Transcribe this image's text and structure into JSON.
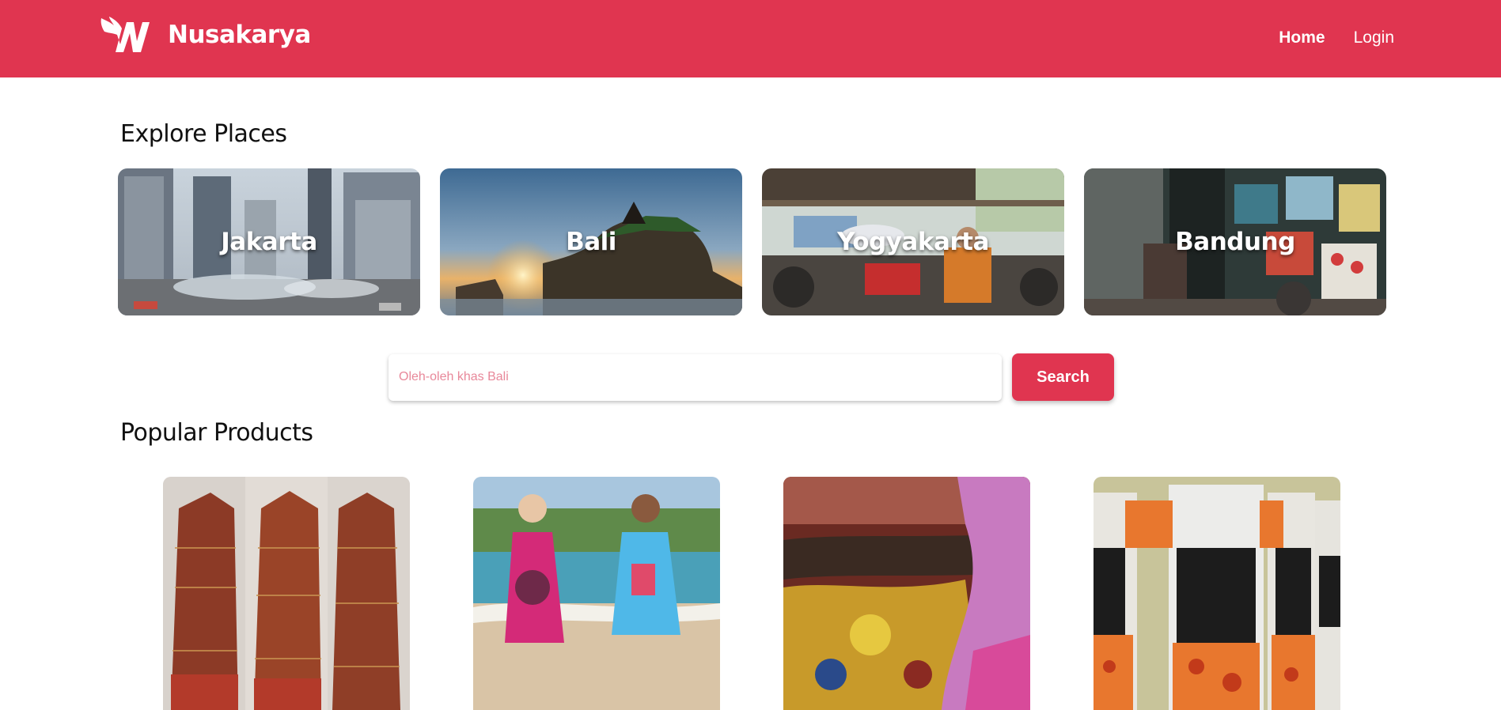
{
  "header": {
    "brand_name": "Nusakarya",
    "nav": [
      {
        "label": "Home",
        "active": true
      },
      {
        "label": "Login",
        "active": false
      }
    ],
    "color": "#e03550"
  },
  "explore": {
    "title": "Explore Places",
    "places": [
      {
        "name": "Jakarta"
      },
      {
        "name": "Bali"
      },
      {
        "name": "Yogyakarta"
      },
      {
        "name": "Bandung"
      }
    ]
  },
  "search": {
    "placeholder": "Oleh-oleh khas Bali",
    "value": "",
    "button_label": "Search"
  },
  "products": {
    "title": "Popular Products"
  }
}
